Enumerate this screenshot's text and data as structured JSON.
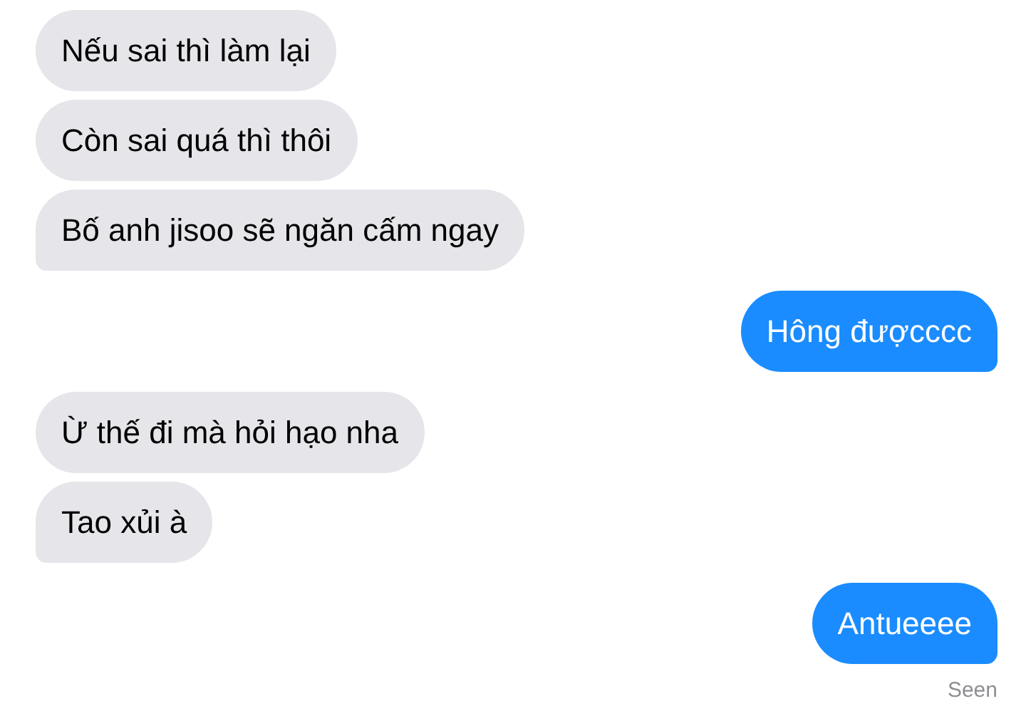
{
  "messages": [
    {
      "outgoing": false,
      "text": "Nếu sai thì làm lại",
      "tail": false
    },
    {
      "outgoing": false,
      "text": "Còn sai quá thì thôi",
      "tail": false
    },
    {
      "outgoing": false,
      "text": "Bố anh jisoo sẽ ngăn cấm ngay",
      "tail": true
    },
    {
      "outgoing": true,
      "text": "Hông đượcccc",
      "tail": true
    },
    {
      "outgoing": false,
      "text": "Ừ thế đi mà hỏi hạo nha",
      "tail": false
    },
    {
      "outgoing": false,
      "text": "Tao xủi à",
      "tail": true
    },
    {
      "outgoing": true,
      "text": "Antueeee",
      "tail": true
    }
  ],
  "receipt": "Seen"
}
